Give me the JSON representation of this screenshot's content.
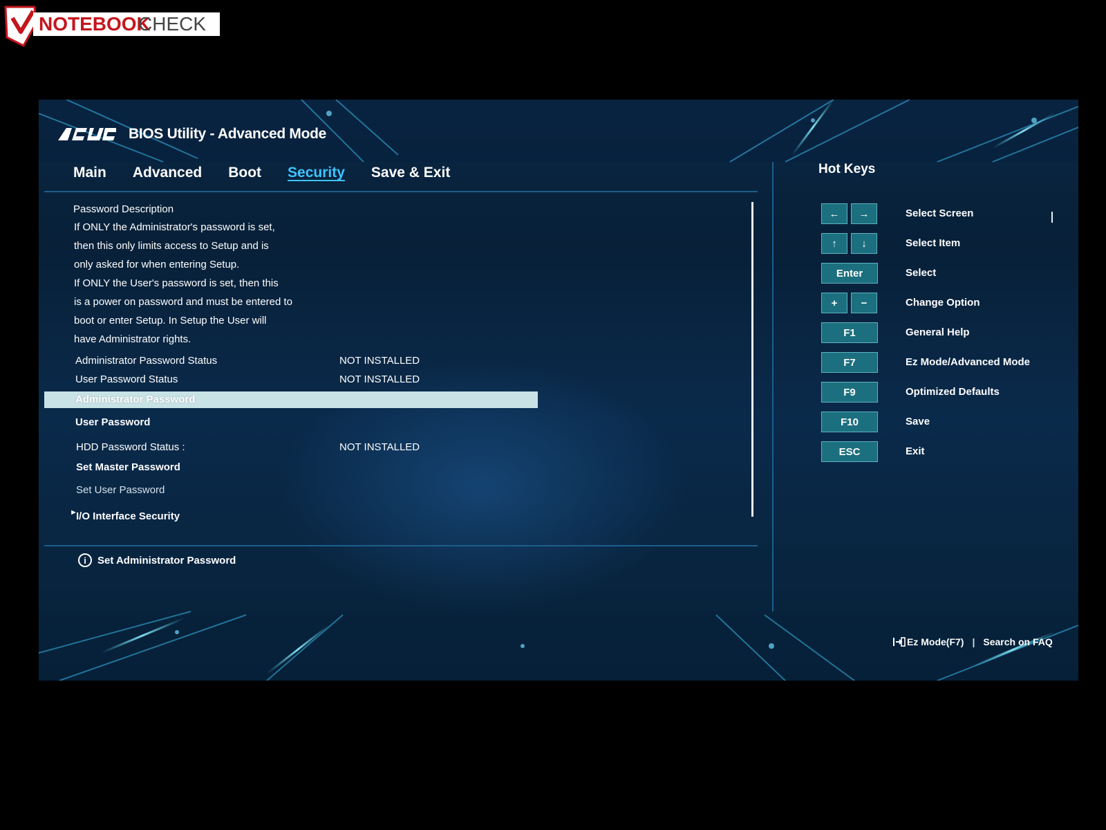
{
  "watermark": {
    "brand_a": "NOTEBOOK",
    "brand_b": "CHECK"
  },
  "header": {
    "logo": "ASUS",
    "title": "BIOS Utility - Advanced Mode"
  },
  "tabs": [
    {
      "label": "Main"
    },
    {
      "label": "Advanced"
    },
    {
      "label": "Boot"
    },
    {
      "label": "Security"
    },
    {
      "label": "Save & Exit"
    }
  ],
  "active_tab": "Security",
  "description": {
    "heading": "Password Description",
    "lines": [
      "If ONLY the Administrator's password is set,",
      "then this only limits access to Setup and is",
      "only asked for when entering Setup.",
      "If ONLY the User's password is set, then this",
      "is a power on password and must be entered to",
      "boot or enter Setup. In Setup the User will",
      "have Administrator rights."
    ]
  },
  "settings": {
    "admin_status_label": "Administrator Password Status",
    "admin_status_value": "NOT INSTALLED",
    "user_status_label": "User Password Status",
    "user_status_value": "NOT INSTALLED",
    "admin_password": "Administrator Password",
    "user_password": "User Password",
    "hdd_status_label": "HDD Password Status  :",
    "hdd_status_value": "NOT INSTALLED",
    "set_master": "Set Master Password",
    "set_user": "Set User Password",
    "io_security": "I/O Interface Security"
  },
  "info": {
    "icon": "i",
    "text": "Set Administrator Password"
  },
  "hotkeys": {
    "title": "Hot Keys",
    "items": [
      {
        "keys": [
          "←",
          "→"
        ],
        "label": "Select Screen"
      },
      {
        "keys": [
          "↑",
          "↓"
        ],
        "label": "Select Item"
      },
      {
        "keys": [
          "Enter"
        ],
        "label": "Select"
      },
      {
        "keys": [
          "+",
          "−"
        ],
        "label": "Change Option"
      },
      {
        "keys": [
          "F1"
        ],
        "label": "General Help"
      },
      {
        "keys": [
          "F7"
        ],
        "label": "Ez Mode/Advanced Mode"
      },
      {
        "keys": [
          "F9"
        ],
        "label": "Optimized Defaults"
      },
      {
        "keys": [
          "F10"
        ],
        "label": "Save"
      },
      {
        "keys": [
          "ESC"
        ],
        "label": "Exit"
      }
    ]
  },
  "footer": {
    "ez_mode": "Ez Mode(F7)",
    "separator": "|",
    "search": "Search on FAQ"
  },
  "colors": {
    "accent_tab": "#3fc3ff",
    "key_bg": "#1c6f7e",
    "selected_row": "#c8e2e6",
    "screen_bg": "#0a2744"
  }
}
